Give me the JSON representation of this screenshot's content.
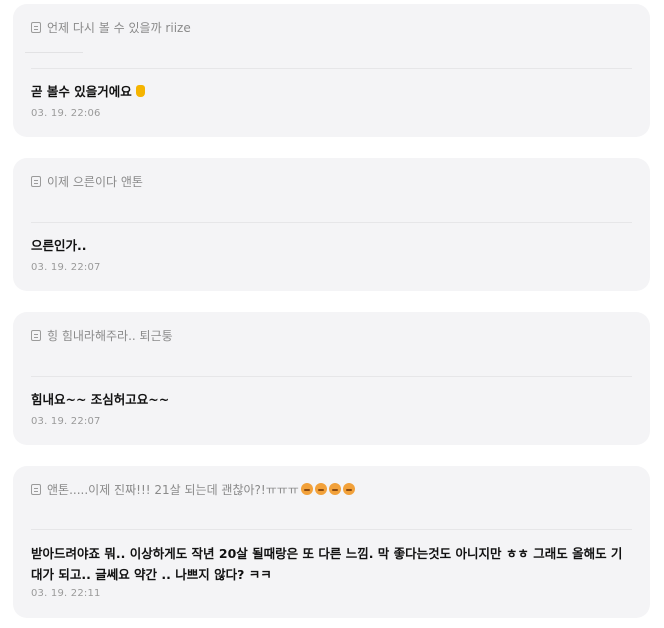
{
  "cards": [
    {
      "question": "언제 다시 볼 수 있을까 riize",
      "answer": "곧 볼수 있을거에요",
      "time": "03. 19. 22:06"
    },
    {
      "question": "이제 으른이다 앤톤",
      "answer": "으른인가..",
      "time": "03. 19. 22:07"
    },
    {
      "question": "힝 힘내라해주라.. 퇴근퉁",
      "answer": "힘내요~~ 조심허고요~~",
      "time": "03. 19. 22:07"
    },
    {
      "question": "앤톤.....이제 진짜!!! 21살 되는데 괜찮아?!ㅠㅠㅠ",
      "answer": "받아드려야죠 뭐.. 이상하게도 작년 20살 될때랑은 또 다른 느낌. 막 좋다는것도 아니지만 ㅎㅎ 그래도 올해도 기대가 되고.. 글쎄요 약간 .. 나쁘지 않다? ㅋㅋ",
      "time": "03. 19. 22:11"
    }
  ],
  "icons": {
    "question": "note-icon",
    "hand": "crossed-fingers-emoji",
    "face": "pleading-face-emoji"
  },
  "colors": {
    "card_bg": "#f4f4f6",
    "question_text": "#8a8a8a",
    "answer_text": "#111111",
    "time_text": "#9a9a9a",
    "emoji": "#f2a13a"
  }
}
